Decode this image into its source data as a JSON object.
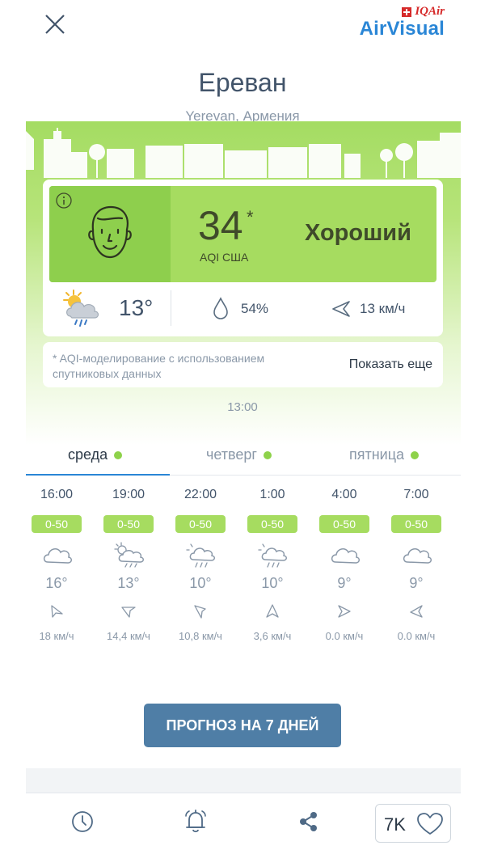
{
  "header": {
    "brand_small": "IQAir",
    "brand_main": "AirVisual"
  },
  "location": {
    "city": "Ереван",
    "country": "Yerevan, Армения"
  },
  "aqi": {
    "value": "34",
    "star": "*",
    "unit": "AQI США",
    "label": "Хороший",
    "color": "#a6dc60"
  },
  "weather": {
    "temp": "13°",
    "humidity": "54%",
    "wind": "13 км/ч"
  },
  "note": {
    "text": "* AQI-моделирование с использованием спутниковых данных",
    "show_more": "Показать еще"
  },
  "timestamp": "13:00",
  "tabs": [
    {
      "label": "среда",
      "active": true
    },
    {
      "label": "четверг",
      "active": false
    },
    {
      "label": "пятница",
      "active": false
    }
  ],
  "hourly": [
    {
      "time": "16:00",
      "aqi": "0-50",
      "icon": "cloudy-icon",
      "temp": "16°",
      "wind": "18 км/ч"
    },
    {
      "time": "19:00",
      "aqi": "0-50",
      "icon": "partly-sunny-rain-icon",
      "temp": "13°",
      "wind": "14,4 км/ч"
    },
    {
      "time": "22:00",
      "aqi": "0-50",
      "icon": "rain-icon",
      "temp": "10°",
      "wind": "10,8 км/ч"
    },
    {
      "time": "1:00",
      "aqi": "0-50",
      "icon": "rain-icon",
      "temp": "10°",
      "wind": "3,6 км/ч"
    },
    {
      "time": "4:00",
      "aqi": "0-50",
      "icon": "cloudy-icon",
      "temp": "9°",
      "wind": "0.0 км/ч"
    },
    {
      "time": "7:00",
      "aqi": "0-50",
      "icon": "cloudy-icon",
      "temp": "9°",
      "wind": "0.0 км/ч"
    }
  ],
  "forecast_button": "ПРОГНОЗ НА 7 ДНЕЙ",
  "footer": {
    "likes": "7K"
  }
}
